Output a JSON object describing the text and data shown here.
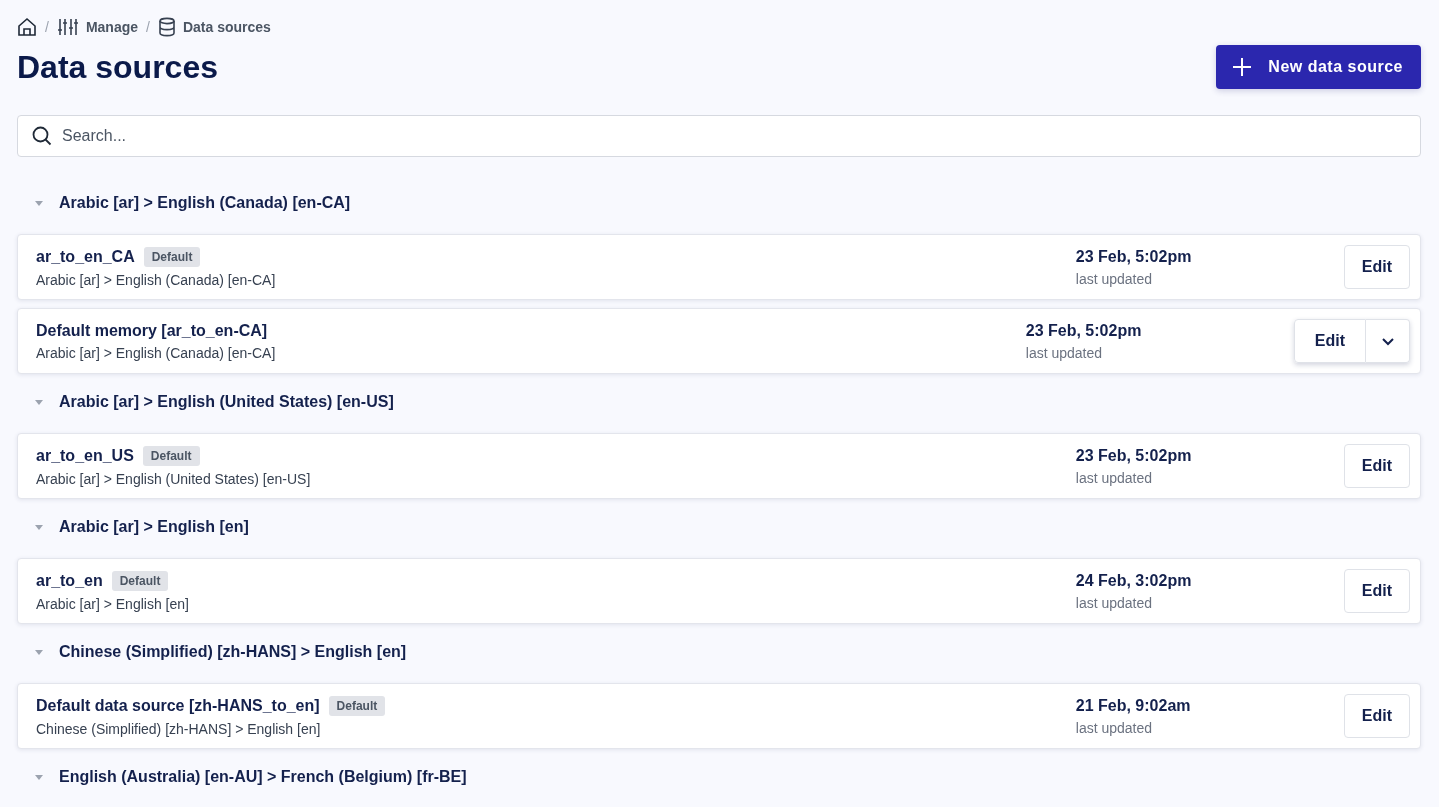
{
  "breadcrumb": [
    {
      "separator": "/",
      "label": "Manage",
      "kind": "sliders"
    },
    {
      "separator": "/",
      "label": "Data sources",
      "kind": "database"
    }
  ],
  "title": "Data sources",
  "new_button": "New data source",
  "search": {
    "placeholder": "Search..."
  },
  "groups": [
    {
      "title": "Arabic [ar] > English (Canada) [en-CA]",
      "expanded": true,
      "items": [
        {
          "name": "ar_to_en_CA",
          "badge": "Default",
          "subtitle": "Arabic [ar] > English (Canada) [en-CA]",
          "date": "23 Feb, 5:02pm",
          "date_label": "last updated",
          "action": "Edit",
          "has_menu": false
        },
        {
          "name": "Default memory [ar_to_en-CA]",
          "subtitle": "Arabic [ar] > English (Canada) [en-CA]",
          "date": "23 Feb, 5:02pm",
          "date_label": "last updated",
          "action": "Edit",
          "has_menu": true
        }
      ]
    },
    {
      "title": "Arabic [ar] > English (United States) [en-US]",
      "expanded": true,
      "items": [
        {
          "name": "ar_to_en_US",
          "badge": "Default",
          "subtitle": "Arabic [ar] > English (United States) [en-US]",
          "date": "23 Feb, 5:02pm",
          "date_label": "last updated",
          "action": "Edit",
          "has_menu": false
        }
      ]
    },
    {
      "title": "Arabic [ar] > English [en]",
      "expanded": true,
      "items": [
        {
          "name": "ar_to_en",
          "badge": "Default",
          "subtitle": "Arabic [ar] > English [en]",
          "date": "24 Feb, 3:02pm",
          "date_label": "last updated",
          "action": "Edit",
          "has_menu": false
        }
      ]
    },
    {
      "title": "Chinese (Simplified) [zh-HANS] > English [en]",
      "expanded": true,
      "items": [
        {
          "name": "Default data source [zh-HANS_to_en]",
          "badge": "Default",
          "subtitle": "Chinese (Simplified) [zh-HANS] > English [en]",
          "date": "21 Feb, 9:02am",
          "date_label": "last updated",
          "action": "Edit",
          "has_menu": false
        }
      ]
    },
    {
      "title": "English (Australia) [en-AU] > French (Belgium) [fr-BE]",
      "expanded": true
    }
  ]
}
